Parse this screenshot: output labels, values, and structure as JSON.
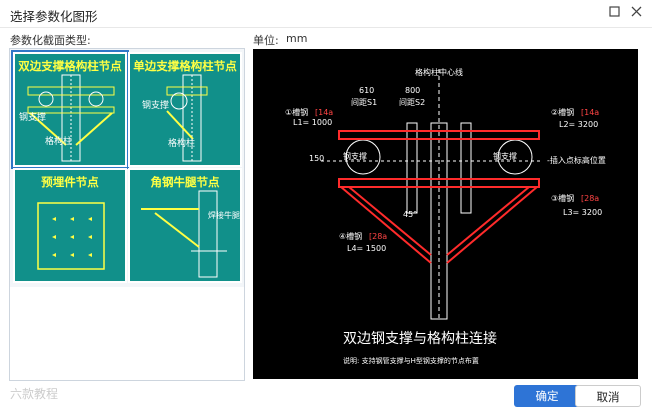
{
  "window": {
    "title": "选择参数化图形",
    "maximize_icon": "maximize-icon",
    "close_icon": "close-icon"
  },
  "left": {
    "label": "参数化截面类型:",
    "items": [
      {
        "title": "双边支撑格构柱节点",
        "annot1": "钢支撑",
        "annot2": "格构柱"
      },
      {
        "title": "单边支撑格构柱节点",
        "annot1": "钢支撑",
        "annot2": "格构柱"
      },
      {
        "title": "预埋件节点"
      },
      {
        "title": "角钢牛腿节点",
        "annot1": "焊接牛腿"
      }
    ]
  },
  "right": {
    "unit_label": "单位:",
    "unit_value": "mm"
  },
  "preview": {
    "title": "双边钢支撑与格构柱连接",
    "note": "说明: 支持钢管支撑与H型钢支撑的节点布置",
    "center_line": "格构柱中心线",
    "dim1": "610",
    "dim2": "800",
    "s1": "间距S1",
    "s2": "间距S2",
    "left_top_label": "①槽钢",
    "left_top_spec": "[14a",
    "left_top_len": "L1= 1000",
    "right_top_label": "②槽钢",
    "right_top_spec": "[14a",
    "right_top_len": "L2= 3200",
    "right_mid_label": "③槽钢",
    "right_mid_spec": "[28a",
    "right_mid_len": "L3= 3200",
    "left_bot_label": "④槽钢",
    "left_bot_spec": "[28a",
    "left_bot_len": "L4= 1500",
    "brace_left": "钢支撑",
    "brace_right": "钢支撑",
    "insert_label": "-插入点标高位置",
    "spacing_v": "间距S3",
    "dim_v": "150",
    "angle": "45°"
  },
  "buttons": {
    "ok": "确定",
    "cancel": "取消"
  },
  "watermark": "六款教程"
}
